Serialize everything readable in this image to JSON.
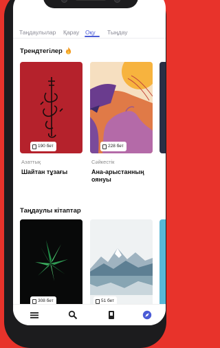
{
  "tabs": [
    "Таңдаулылар",
    "Қарау",
    "Оқу",
    "Тыңдау"
  ],
  "active_tab": "Оқу",
  "trending": {
    "title": "Трендтегілер",
    "books": [
      {
        "pages": "190 бет",
        "category": "Азаттық",
        "title": "Шайтан тұзағы"
      },
      {
        "pages": "228 бет",
        "category": "Сәйкестік",
        "title_line1": "Ана-арыстанның",
        "title_line2": "оянуы"
      }
    ]
  },
  "favorites": {
    "title": "Таңдаулы кітаптар",
    "books": [
      {
        "pages": "308 бет"
      },
      {
        "pages": "51 бет"
      }
    ]
  },
  "colors": {
    "accent": "#4a5bd6",
    "background": "#e8332b"
  },
  "bottom_nav_icons": [
    "menu-icon",
    "search-icon",
    "book-icon",
    "compass-icon"
  ]
}
